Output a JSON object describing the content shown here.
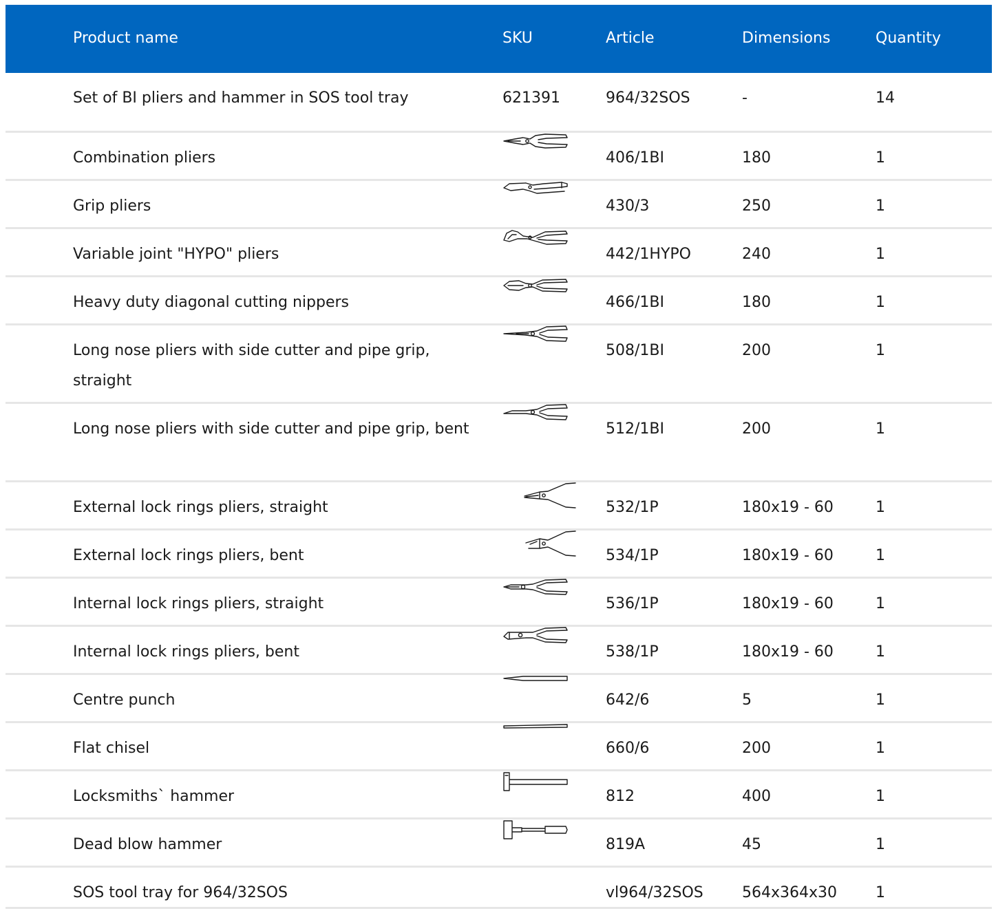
{
  "header": {
    "product_name": "Product name",
    "sku": "SKU",
    "article": "Article",
    "dimensions": "Dimensions",
    "quantity": "Quantity"
  },
  "colors": {
    "header_bg": "#0066bf",
    "header_text": "#ffffff",
    "row_divider": "#e6e6e6"
  },
  "rows": [
    {
      "name": "Set of BI pliers and hammer in SOS tool tray",
      "sku": "621391",
      "sku_icon": "",
      "article": "964/32SOS",
      "dimensions": "-",
      "quantity": "14"
    },
    {
      "name": "Combination pliers",
      "sku": "",
      "sku_icon": "combination-pliers-icon",
      "article": "406/1BI",
      "dimensions": "180",
      "quantity": "1"
    },
    {
      "name": "Grip pliers",
      "sku": "",
      "sku_icon": "grip-pliers-icon",
      "article": "430/3",
      "dimensions": "250",
      "quantity": "1"
    },
    {
      "name": "Variable joint \"HYPO\" pliers",
      "sku": "",
      "sku_icon": "variable-joint-pliers-icon",
      "article": "442/1HYPO",
      "dimensions": "240",
      "quantity": "1"
    },
    {
      "name": "Heavy duty diagonal cutting nippers",
      "sku": "",
      "sku_icon": "diagonal-nippers-icon",
      "article": "466/1BI",
      "dimensions": "180",
      "quantity": "1"
    },
    {
      "name": "Long nose pliers with side cutter and pipe grip, straight",
      "sku": "",
      "sku_icon": "long-nose-pliers-straight-icon",
      "article": "508/1BI",
      "dimensions": "200",
      "quantity": "1"
    },
    {
      "name": "Long nose pliers with side cutter and pipe grip, bent",
      "sku": "",
      "sku_icon": "long-nose-pliers-bent-icon",
      "article": "512/1BI",
      "dimensions": "200",
      "quantity": "1"
    },
    {
      "name": "External lock rings pliers, straight",
      "sku": "",
      "sku_icon": "external-lock-ring-pliers-straight-icon",
      "article": "532/1P",
      "dimensions": "180x19 - 60",
      "quantity": "1"
    },
    {
      "name": "External lock rings pliers, bent",
      "sku": "",
      "sku_icon": "external-lock-ring-pliers-bent-icon",
      "article": "534/1P",
      "dimensions": "180x19 - 60",
      "quantity": "1"
    },
    {
      "name": "Internal lock rings pliers, straight",
      "sku": "",
      "sku_icon": "internal-lock-ring-pliers-straight-icon",
      "article": "536/1P",
      "dimensions": "180x19 - 60",
      "quantity": "1"
    },
    {
      "name": "Internal lock rings pliers, bent",
      "sku": "",
      "sku_icon": "internal-lock-ring-pliers-bent-icon",
      "article": "538/1P",
      "dimensions": "180x19 - 60",
      "quantity": "1"
    },
    {
      "name": "Centre punch",
      "sku": "",
      "sku_icon": "centre-punch-icon",
      "article": "642/6",
      "dimensions": "5",
      "quantity": "1"
    },
    {
      "name": "Flat chisel",
      "sku": "",
      "sku_icon": "flat-chisel-icon",
      "article": "660/6",
      "dimensions": "200",
      "quantity": "1"
    },
    {
      "name": "Locksmiths` hammer",
      "sku": "",
      "sku_icon": "locksmith-hammer-icon",
      "article": "812",
      "dimensions": "400",
      "quantity": "1"
    },
    {
      "name": "Dead blow hammer",
      "sku": "",
      "sku_icon": "dead-blow-hammer-icon",
      "article": "819A",
      "dimensions": "45",
      "quantity": "1"
    },
    {
      "name": "SOS tool tray for 964/32SOS",
      "sku": "",
      "sku_icon": "",
      "article": "vl964/32SOS",
      "dimensions": "564x364x30",
      "quantity": "1"
    }
  ]
}
